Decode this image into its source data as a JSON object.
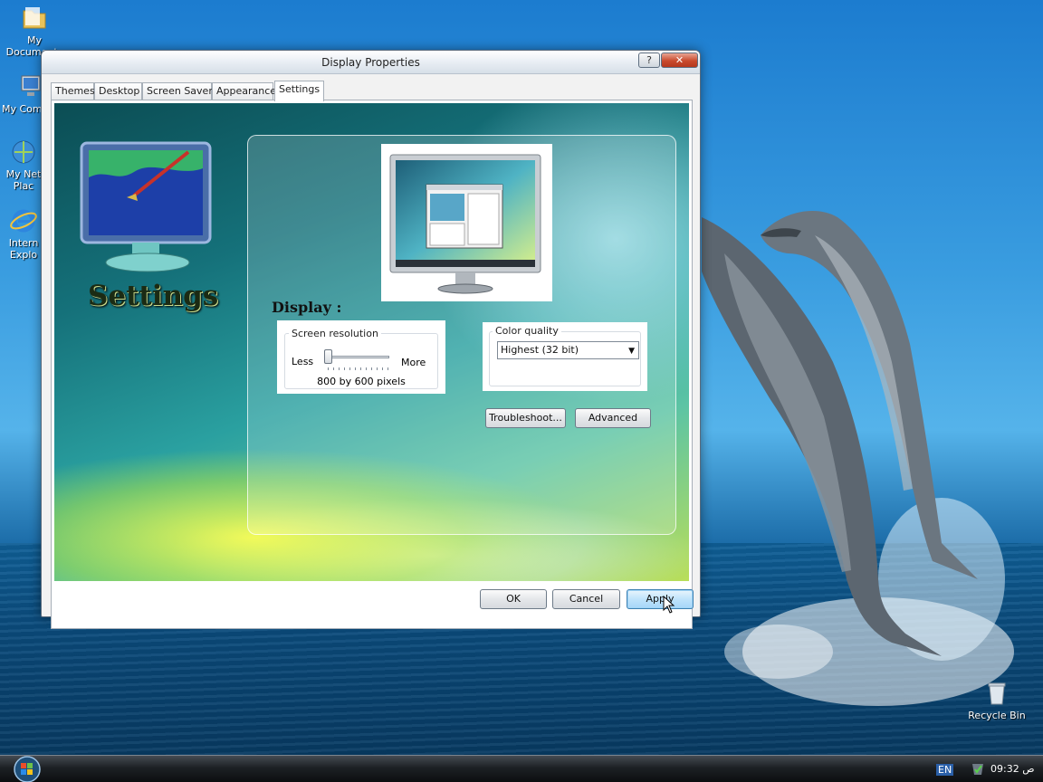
{
  "desktop": {
    "icons": [
      {
        "label": "My Documents",
        "icon": "folder-icon"
      },
      {
        "label": "My Com",
        "icon": "computer-icon"
      },
      {
        "label": "My Net Plac",
        "icon": "network-icon"
      },
      {
        "label": "Intern Explo",
        "icon": "ie-icon"
      },
      {
        "label": "Recycle Bin",
        "icon": "recycle-bin-icon"
      }
    ]
  },
  "window": {
    "title": "Display Properties",
    "help_label": "?",
    "close_label": "✕",
    "tabs": [
      {
        "label": "Themes",
        "active": false
      },
      {
        "label": "Desktop",
        "active": false
      },
      {
        "label": "Screen Saver",
        "active": false
      },
      {
        "label": "Appearance",
        "active": false
      },
      {
        "label": "Settings",
        "active": true
      }
    ],
    "heading": "Settings",
    "display_label": "Display :",
    "screen_resolution": {
      "legend": "Screen resolution",
      "less_label": "Less",
      "more_label": "More",
      "value_text": "800 by 600 pixels",
      "slider_level": 0
    },
    "color_quality": {
      "legend": "Color quality",
      "selected": "Highest (32 bit)"
    },
    "troubleshoot_label": "Troubleshoot...",
    "advanced_label": "Advanced",
    "ok_label": "OK",
    "cancel_label": "Cancel",
    "apply_label": "Apply"
  },
  "taskbar": {
    "language": "EN",
    "clock": "ص 09:32"
  },
  "colors": {
    "close_button": "#c94a2d",
    "default_button": "#bfe3fb",
    "taskbar": "#1d2125"
  }
}
